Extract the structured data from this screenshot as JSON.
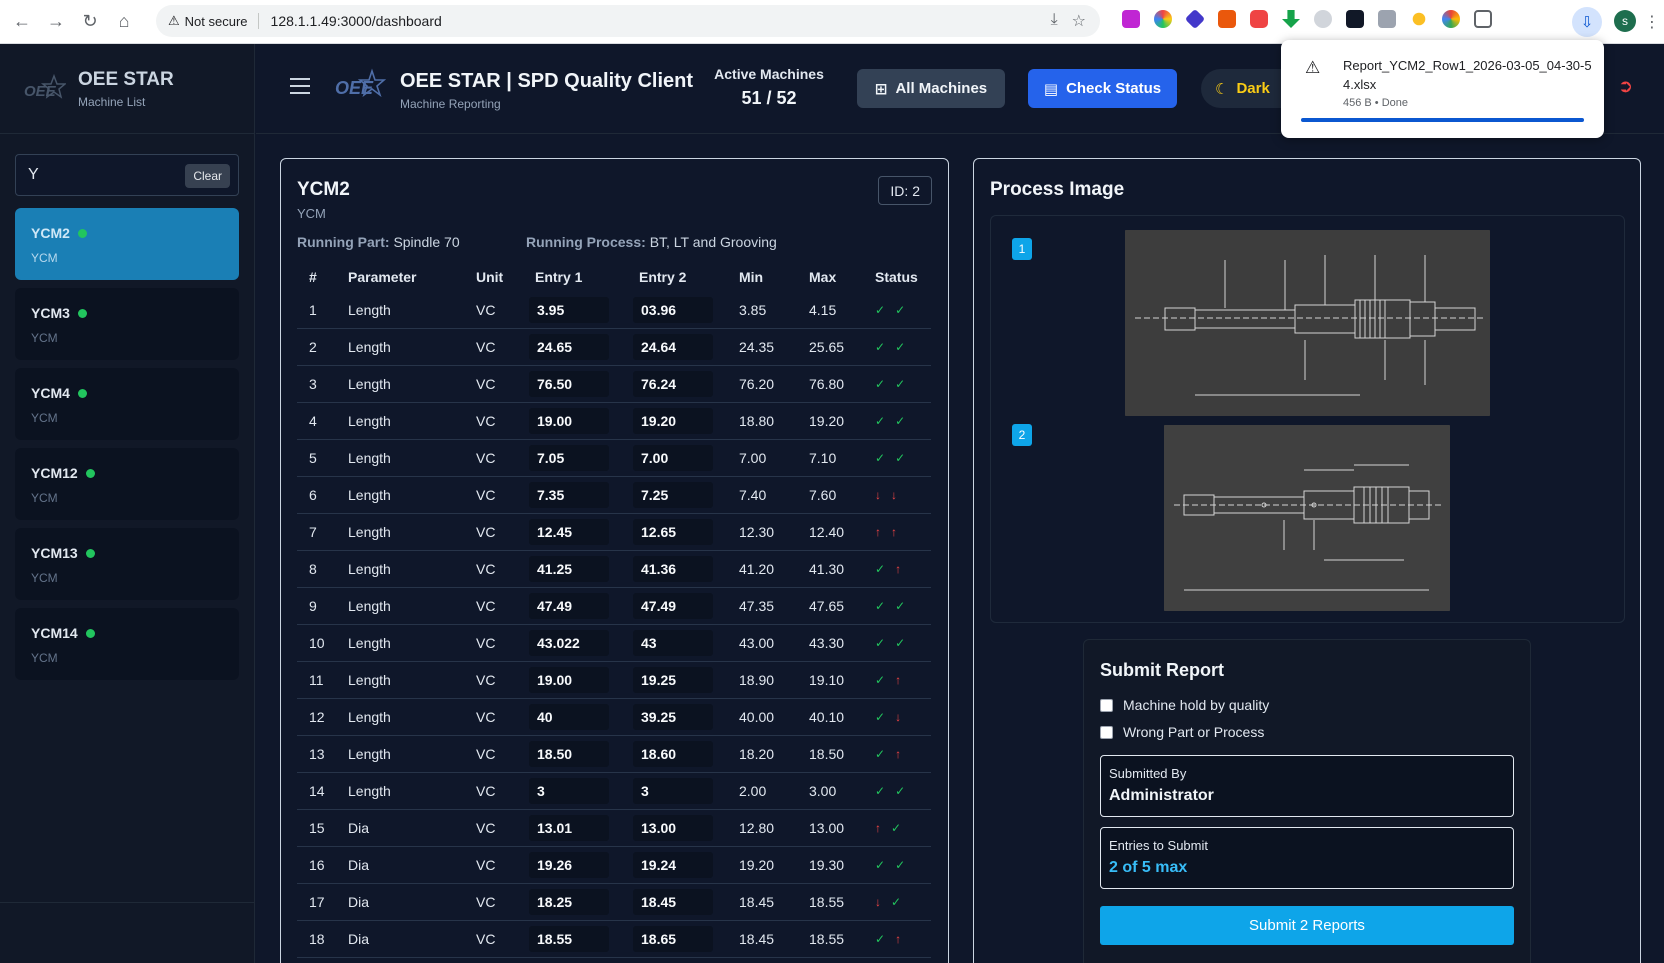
{
  "browser": {
    "security_label": "Not secure",
    "url": "128.1.1.49:3000/dashboard",
    "profile_initial": "s"
  },
  "download": {
    "filename": "Report_YCM2_Row1_2026-03-05_04-30-54.xlsx",
    "meta": "456 B • Done"
  },
  "sidebar": {
    "title": "OEE STAR",
    "subtitle": "Machine List",
    "search_value": "Y",
    "clear_label": "Clear",
    "machines": [
      {
        "name": "YCM2",
        "type": "YCM",
        "active": true
      },
      {
        "name": "YCM3",
        "type": "YCM",
        "active": false
      },
      {
        "name": "YCM4",
        "type": "YCM",
        "active": false
      },
      {
        "name": "YCM12",
        "type": "YCM",
        "active": false
      },
      {
        "name": "YCM13",
        "type": "YCM",
        "active": false
      },
      {
        "name": "YCM14",
        "type": "YCM",
        "active": false
      }
    ]
  },
  "header": {
    "title": "OEE STAR | SPD Quality Client",
    "subtitle": "Machine Reporting",
    "active_label": "Active Machines",
    "active_value": "51 / 52",
    "all_machines_label": "All Machines",
    "check_status_label": "Check Status",
    "dark_label": "Dark"
  },
  "machine": {
    "name": "YCM2",
    "type": "YCM",
    "id_label": "ID: 2",
    "running_part_label": "Running Part:",
    "running_part": "Spindle 70",
    "running_process_label": "Running Process:",
    "running_process": "BT, LT and Grooving"
  },
  "table": {
    "headers": [
      "#",
      "Parameter",
      "Unit",
      "Entry 1",
      "Entry 2",
      "Min",
      "Max",
      "Status"
    ],
    "rows": [
      {
        "n": "1",
        "param": "Length",
        "unit": "VC",
        "e1": "3.95",
        "e2": "03.96",
        "min": "3.85",
        "max": "4.15",
        "s1": "ok",
        "s2": "ok"
      },
      {
        "n": "2",
        "param": "Length",
        "unit": "VC",
        "e1": "24.65",
        "e2": "24.64",
        "min": "24.35",
        "max": "25.65",
        "s1": "ok",
        "s2": "ok"
      },
      {
        "n": "3",
        "param": "Length",
        "unit": "VC",
        "e1": "76.50",
        "e2": "76.24",
        "min": "76.20",
        "max": "76.80",
        "s1": "ok",
        "s2": "ok"
      },
      {
        "n": "4",
        "param": "Length",
        "unit": "VC",
        "e1": "19.00",
        "e2": "19.20",
        "min": "18.80",
        "max": "19.20",
        "s1": "ok",
        "s2": "ok"
      },
      {
        "n": "5",
        "param": "Length",
        "unit": "VC",
        "e1": "7.05",
        "e2": "7.00",
        "min": "7.00",
        "max": "7.10",
        "s1": "ok",
        "s2": "ok"
      },
      {
        "n": "6",
        "param": "Length",
        "unit": "VC",
        "e1": "7.35",
        "e2": "7.25",
        "min": "7.40",
        "max": "7.60",
        "s1": "down",
        "s2": "down"
      },
      {
        "n": "7",
        "param": "Length",
        "unit": "VC",
        "e1": "12.45",
        "e2": "12.65",
        "min": "12.30",
        "max": "12.40",
        "s1": "up",
        "s2": "up"
      },
      {
        "n": "8",
        "param": "Length",
        "unit": "VC",
        "e1": "41.25",
        "e2": "41.36",
        "min": "41.20",
        "max": "41.30",
        "s1": "ok",
        "s2": "up"
      },
      {
        "n": "9",
        "param": "Length",
        "unit": "VC",
        "e1": "47.49",
        "e2": "47.49",
        "min": "47.35",
        "max": "47.65",
        "s1": "ok",
        "s2": "ok"
      },
      {
        "n": "10",
        "param": "Length",
        "unit": "VC",
        "e1": "43.022",
        "e2": "43",
        "min": "43.00",
        "max": "43.30",
        "s1": "ok",
        "s2": "ok"
      },
      {
        "n": "11",
        "param": "Length",
        "unit": "VC",
        "e1": "19.00",
        "e2": "19.25",
        "min": "18.90",
        "max": "19.10",
        "s1": "ok",
        "s2": "up"
      },
      {
        "n": "12",
        "param": "Length",
        "unit": "VC",
        "e1": "40",
        "e2": "39.25",
        "min": "40.00",
        "max": "40.10",
        "s1": "ok",
        "s2": "down"
      },
      {
        "n": "13",
        "param": "Length",
        "unit": "VC",
        "e1": "18.50",
        "e2": "18.60",
        "min": "18.20",
        "max": "18.50",
        "s1": "ok",
        "s2": "up"
      },
      {
        "n": "14",
        "param": "Length",
        "unit": "VC",
        "e1": "3",
        "e2": "3",
        "min": "2.00",
        "max": "3.00",
        "s1": "ok",
        "s2": "ok"
      },
      {
        "n": "15",
        "param": "Dia",
        "unit": "VC",
        "e1": "13.01",
        "e2": "13.00",
        "min": "12.80",
        "max": "13.00",
        "s1": "up",
        "s2": "ok"
      },
      {
        "n": "16",
        "param": "Dia",
        "unit": "VC",
        "e1": "19.26",
        "e2": "19.24",
        "min": "19.20",
        "max": "19.30",
        "s1": "ok",
        "s2": "ok"
      },
      {
        "n": "17",
        "param": "Dia",
        "unit": "VC",
        "e1": "18.25",
        "e2": "18.45",
        "min": "18.45",
        "max": "18.55",
        "s1": "down",
        "s2": "ok"
      },
      {
        "n": "18",
        "param": "Dia",
        "unit": "VC",
        "e1": "18.55",
        "e2": "18.65",
        "min": "18.45",
        "max": "18.55",
        "s1": "ok",
        "s2": "up"
      }
    ]
  },
  "process": {
    "title": "Process Image",
    "images": [
      {
        "index": "1"
      },
      {
        "index": "2"
      }
    ]
  },
  "submit": {
    "title": "Submit Report",
    "hold_label": "Machine hold by quality",
    "wrong_label": "Wrong Part or Process",
    "submitted_by_label": "Submitted By",
    "submitted_by": "Administrator",
    "entries_label": "Entries to Submit",
    "entries_value": "2 of 5 max",
    "button_label": "Submit 2 Reports"
  },
  "colors": {
    "accent": "#0ea5e9",
    "primary_button": "#2563eb",
    "ok": "#22c55e",
    "fail": "#ef4444"
  }
}
